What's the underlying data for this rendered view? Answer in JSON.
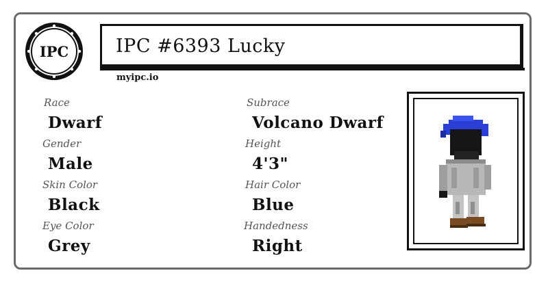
{
  "card": {
    "title": "IPC #6393 Lucky",
    "site": "myipc.io",
    "logo_text": "IPC"
  },
  "attributes": {
    "race": {
      "label": "Race",
      "value": "Dwarf"
    },
    "subrace": {
      "label": "Subrace",
      "value": "Volcano Dwarf"
    },
    "gender": {
      "label": "Gender",
      "value": "Male"
    },
    "height": {
      "label": "Height",
      "value": "4'3\""
    },
    "skin_color": {
      "label": "Skin Color",
      "value": "Black"
    },
    "hair_color": {
      "label": "Hair Color",
      "value": "Blue"
    },
    "eye_color": {
      "label": "Eye Color",
      "value": "Grey"
    },
    "handedness": {
      "label": "Handedness",
      "value": "Right"
    }
  },
  "portrait": {
    "icon": "dwarf-character-sprite",
    "colors": {
      "hair": "#2a3fd6",
      "skin": "#151515",
      "armor": "#b8b8b8",
      "boots": "#7a4a22"
    }
  }
}
